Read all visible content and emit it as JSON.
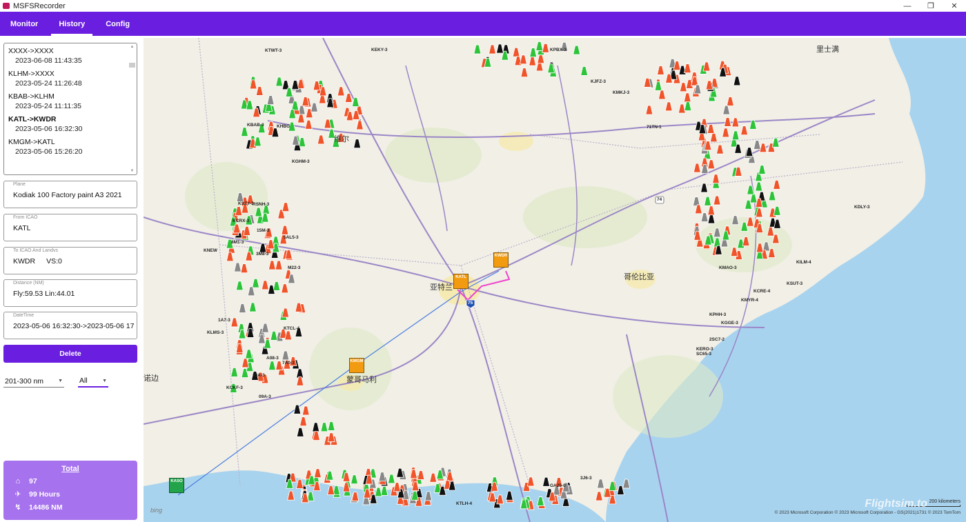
{
  "window": {
    "title": "MSFSRecorder",
    "controls": {
      "minimize": "—",
      "maximize": "❐",
      "close": "✕"
    }
  },
  "nav": {
    "tabs": [
      {
        "label": "Monitor"
      },
      {
        "label": "History"
      },
      {
        "label": "Config"
      }
    ]
  },
  "history": [
    {
      "route": "XXXX->XXXX",
      "date": "2023-06-08 11:43:35"
    },
    {
      "route": "KLHM->XXXX",
      "date": "2023-05-24 11:26:48"
    },
    {
      "route": "KBAB->KLHM",
      "date": "2023-05-24 11:11:35"
    },
    {
      "route": "KATL->KWDR",
      "date": "2023-05-06 16:32:30"
    },
    {
      "route": "KMGM->KATL",
      "date": "2023-05-06 15:26:20"
    }
  ],
  "fields": {
    "plane": {
      "label": "Plane",
      "value": "Kodiak 100 Factory paint A3 2021"
    },
    "from": {
      "label": "From ICAO",
      "value": "KATL"
    },
    "to": {
      "label": "To ICAO And Landvs",
      "icao": "KWDR",
      "vs": "VS:0"
    },
    "distance": {
      "label": "Distance (NM)",
      "fly": "Fly:59.53",
      "line": "Lin:44.01"
    },
    "datetime": {
      "label": "DateTime",
      "value": "2023-05-06 16:32:30->2023-05-06 17"
    }
  },
  "delete_label": "Delete",
  "filters": {
    "range": "201-300 nm",
    "type": "All"
  },
  "total": {
    "title": "Total",
    "flights": "97",
    "hours": "99 Hours",
    "distance": "14486 NM"
  },
  "map": {
    "city_labels": [
      "亚特兰",
      "哥伦比亚",
      "蒙哥马利",
      "里士满",
      "维尔",
      "诺边"
    ],
    "route_tags": [
      {
        "code": "KATL",
        "color": "orange"
      },
      {
        "code": "KWDR",
        "color": "orange"
      },
      {
        "code": "KMGM",
        "color": "orange"
      },
      {
        "code": "KASO",
        "color": "green"
      }
    ],
    "airport_labels": [
      "KLMS-3",
      "KTCL-4",
      "KGHM-3",
      "15M-3",
      "8M1-3",
      "KNEW",
      "2SC7-2",
      "KGGE-3",
      "KMYR-4",
      "KSUT-3",
      "KILM-4",
      "KMAO-3",
      "KPBX-3",
      "KHBG",
      "KDLY-3",
      "5AL5-3",
      "3M8-3",
      "M22-3",
      "23A-3",
      "A08-3",
      "09A-3",
      "7A0-3",
      "KEKY-3",
      "KTWT-3",
      "KMKJ-3",
      "KJFZ-3",
      "71TN-1",
      "KCRX-3",
      "KSZY-3",
      "3J6-3",
      "GA25-0",
      "KTLH-4",
      "KCKF-3",
      "KCRE-4",
      "SC65-3",
      "KERO-3",
      "KPHH-3",
      "1A7-3",
      "RSNH-3",
      "KBAB-3"
    ],
    "highway_labels": [
      "74",
      "75"
    ],
    "scale": "200 kilometers",
    "copyright": "© 2023 Microsoft Corporation   © 2023 Microsoft Corporation - GS(2021)1731   © 2023 TomTom",
    "bing_label": "bing",
    "watermark": "Flightsim.to"
  }
}
